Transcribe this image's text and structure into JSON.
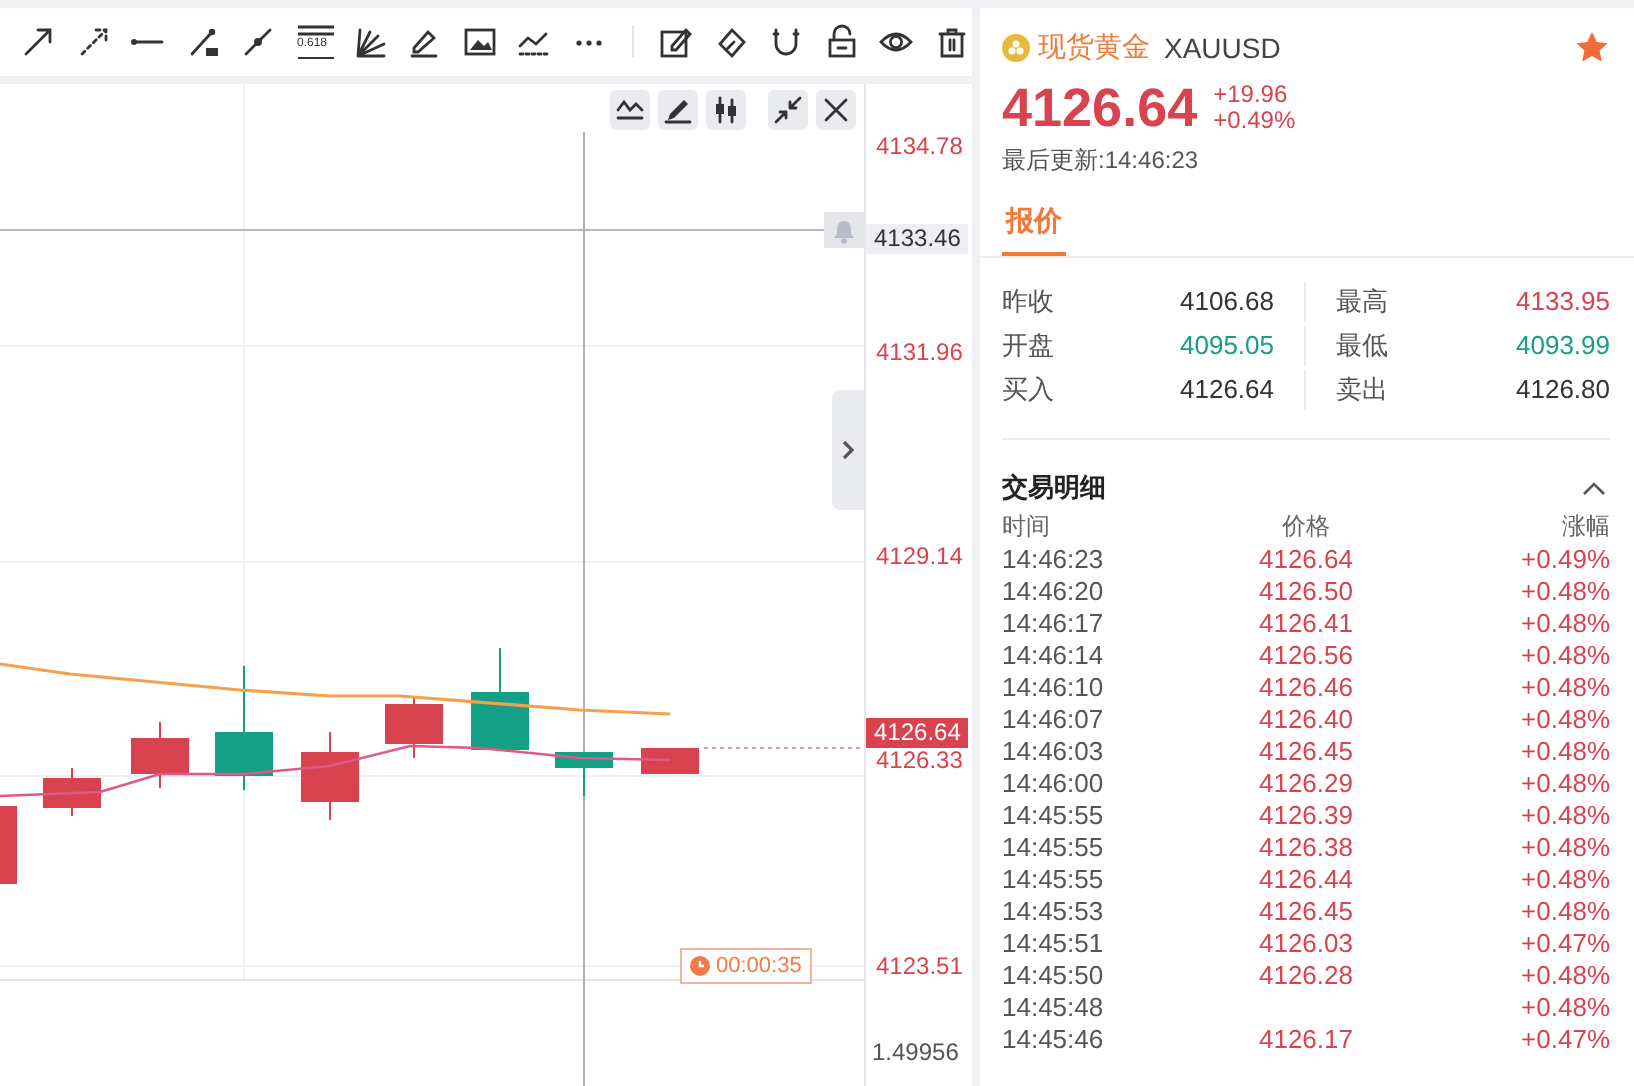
{
  "toolbar": {
    "drawing_tools": [
      {
        "kind": "arrow"
      },
      {
        "kind": "ray"
      },
      {
        "kind": "hline"
      },
      {
        "kind": "segment"
      },
      {
        "kind": "line"
      },
      {
        "kind": "fib",
        "label": "0.618"
      },
      {
        "kind": "fan"
      },
      {
        "kind": "brush"
      },
      {
        "kind": "image"
      },
      {
        "kind": "wave"
      },
      {
        "kind": "more"
      }
    ],
    "edit_tools": [
      {
        "kind": "note"
      },
      {
        "kind": "eraser"
      },
      {
        "kind": "magnet"
      },
      {
        "kind": "lock",
        "locked": false
      },
      {
        "kind": "eye"
      },
      {
        "kind": "trash"
      }
    ]
  },
  "chart": {
    "controls": [
      {
        "kind": "indicator"
      },
      {
        "kind": "pen"
      },
      {
        "kind": "candles"
      },
      {
        "kind": "collapse"
      },
      {
        "kind": "close"
      }
    ],
    "price_axis": [
      {
        "label": "4134.78"
      },
      {
        "label": "4131.96"
      },
      {
        "label": "4129.14"
      },
      {
        "label": "4126.33"
      },
      {
        "label": "4123.51"
      }
    ],
    "alert": {
      "price": "4133.46"
    },
    "last_price": {
      "price": "4126.64"
    },
    "countdown": "00:00:35",
    "indicator_axis": {
      "label": "1.49956"
    }
  },
  "instrument": {
    "name": "现货黄金",
    "symbol": "XAUUSD",
    "favorite": true
  },
  "quote": {
    "price": "4126.64",
    "change": "+19.96",
    "change_pct": "+0.49%",
    "color": "#d9434f",
    "updated": "最后更新:14:46:23"
  },
  "tabs": [
    {
      "label": "报价",
      "selected": true
    }
  ],
  "stats": [
    {
      "label": "昨收",
      "value": "4106.68",
      "color": "#333333"
    },
    {
      "label": "最高",
      "value": "4133.95",
      "color": "#d9434f"
    },
    {
      "label": "开盘",
      "value": "4095.05",
      "color": "#14a085"
    },
    {
      "label": "最低",
      "value": "4093.99",
      "color": "#14a085"
    },
    {
      "label": "买入",
      "value": "4126.64",
      "color": "#333333"
    },
    {
      "label": "卖出",
      "value": "4126.80",
      "color": "#333333"
    }
  ],
  "trades": {
    "title": "交易明细",
    "expanded": true,
    "columns": [
      "时间",
      "价格",
      "涨幅"
    ],
    "rows": [
      {
        "time": "14:46:23",
        "price": "4126.64",
        "change": "+0.49%"
      },
      {
        "time": "14:46:20",
        "price": "4126.50",
        "change": "+0.48%"
      },
      {
        "time": "14:46:17",
        "price": "4126.41",
        "change": "+0.48%"
      },
      {
        "time": "14:46:14",
        "price": "4126.56",
        "change": "+0.48%"
      },
      {
        "time": "14:46:10",
        "price": "4126.46",
        "change": "+0.48%"
      },
      {
        "time": "14:46:07",
        "price": "4126.40",
        "change": "+0.48%"
      },
      {
        "time": "14:46:03",
        "price": "4126.45",
        "change": "+0.48%"
      },
      {
        "time": "14:46:00",
        "price": "4126.29",
        "change": "+0.48%"
      },
      {
        "time": "14:45:55",
        "price": "4126.39",
        "change": "+0.48%"
      },
      {
        "time": "14:45:55",
        "price": "4126.38",
        "change": "+0.48%"
      },
      {
        "time": "14:45:55",
        "price": "4126.44",
        "change": "+0.48%"
      },
      {
        "time": "14:45:53",
        "price": "4126.45",
        "change": "+0.48%"
      },
      {
        "time": "14:45:51",
        "price": "4126.03",
        "change": "+0.47%"
      },
      {
        "time": "14:45:50",
        "price": "4126.28",
        "change": "+0.48%"
      },
      {
        "time": "14:45:48",
        "change": "+0.48%"
      },
      {
        "time": "14:45:46",
        "price": "4126.17",
        "change": "+0.47%"
      }
    ]
  }
}
